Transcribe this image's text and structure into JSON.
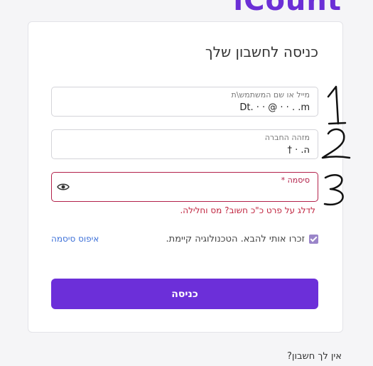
{
  "brand": {
    "logo_text": "iCount"
  },
  "login": {
    "title": "כניסה לחשבון שלך",
    "username_label": "מייל או שם המשתמש\\ת",
    "username_value": "Dt.  ·  ·  @  ·  ·  .  .m",
    "company_label": "מזהה החברה",
    "company_value": "ה.  ·  †",
    "password_label": "סיסמה *",
    "password_value": "",
    "password_error": "לדלג על פרט כ\"כ חשוב? מס וחלילה.",
    "remember_label": "זכרו אותי להבא. הטכנולוגיה קיימת.",
    "remember_checked": true,
    "forgot_label": "איפוס סיסמה",
    "submit_label": "כניסה",
    "no_account_label": "אין לך חשבון?"
  },
  "annotations": [
    "1",
    "2",
    "3"
  ],
  "colors": {
    "accent": "#6c2fd9",
    "error": "#b3214a",
    "link": "#3b6fd8"
  },
  "icons": {
    "password_toggle": "eye-icon",
    "remember": "checkbox-checked-icon"
  }
}
